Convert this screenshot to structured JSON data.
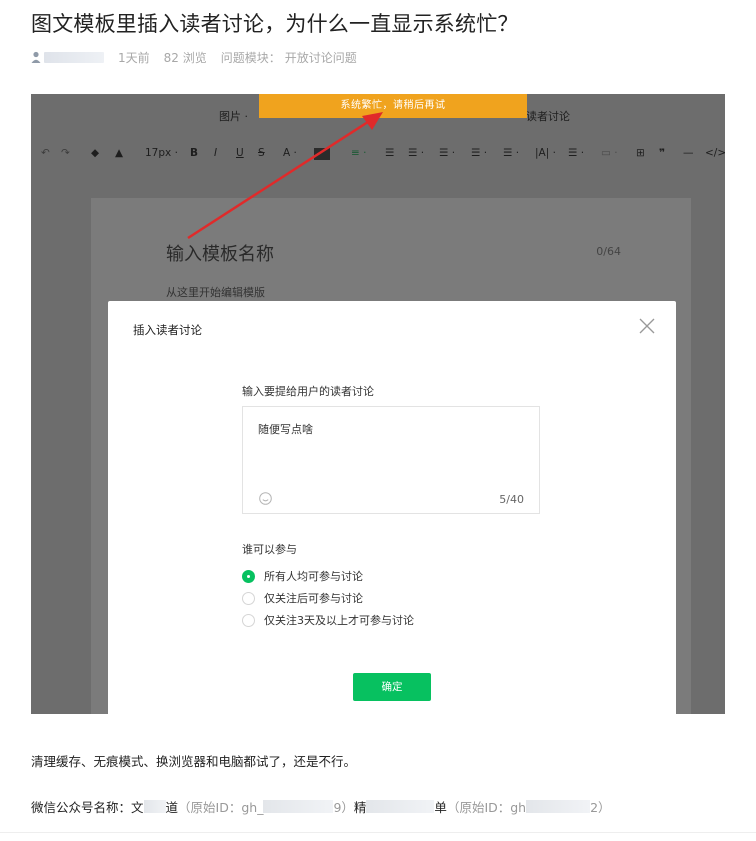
{
  "post": {
    "title": "图文模板里插入读者讨论，为什么一直显示系统忙？",
    "time_ago": "1天前",
    "views": "82 浏览",
    "category_label": "问题模块：",
    "category_value": "开放讨论问题"
  },
  "screenshot": {
    "toolbar_top": {
      "image_label": "图片 ·",
      "reader_discussion_label": "读者讨论"
    },
    "toast": "系统繁忙，请稍后再试",
    "toolbar_format": {
      "font_size": "17px ·",
      "bold": "B",
      "italic": "I",
      "underline": "U",
      "strike": "S",
      "font_color": "A ·"
    },
    "editor": {
      "template_name_placeholder": "输入模板名称",
      "template_name_count": "0/64",
      "body_hint": "从这里开始编辑模版"
    },
    "dialog": {
      "title": "插入读者讨论",
      "field_label": "输入要提给用户的读者讨论",
      "textarea_value": "随便写点啥",
      "textarea_count": "5/40",
      "who_label": "谁可以参与",
      "options": [
        {
          "label": "所有人均可参与讨论",
          "checked": true
        },
        {
          "label": "仅关注后可参与讨论",
          "checked": false
        },
        {
          "label": "仅关注3天及以上才可参与讨论",
          "checked": false
        }
      ],
      "confirm_label": "确定"
    }
  },
  "content": {
    "paragraph": "清理缓存、无痕模式、换浏览器和电脑都试了，还是不行。",
    "wx_prefix": "微信公众号名称：文",
    "wx_name1_tail": "道",
    "wx_orig_open": "（原始ID：gh_",
    "wx_orig_tail": "9）",
    "wx_name2_head": "精",
    "wx_name2_tail": "单",
    "wx_orig2_open": "（原始ID：gh",
    "wx_orig2_tail": "2）"
  },
  "colors": {
    "toast": "#f0a31e",
    "primary_green": "#07c160",
    "arrow": "#e02a2a"
  }
}
